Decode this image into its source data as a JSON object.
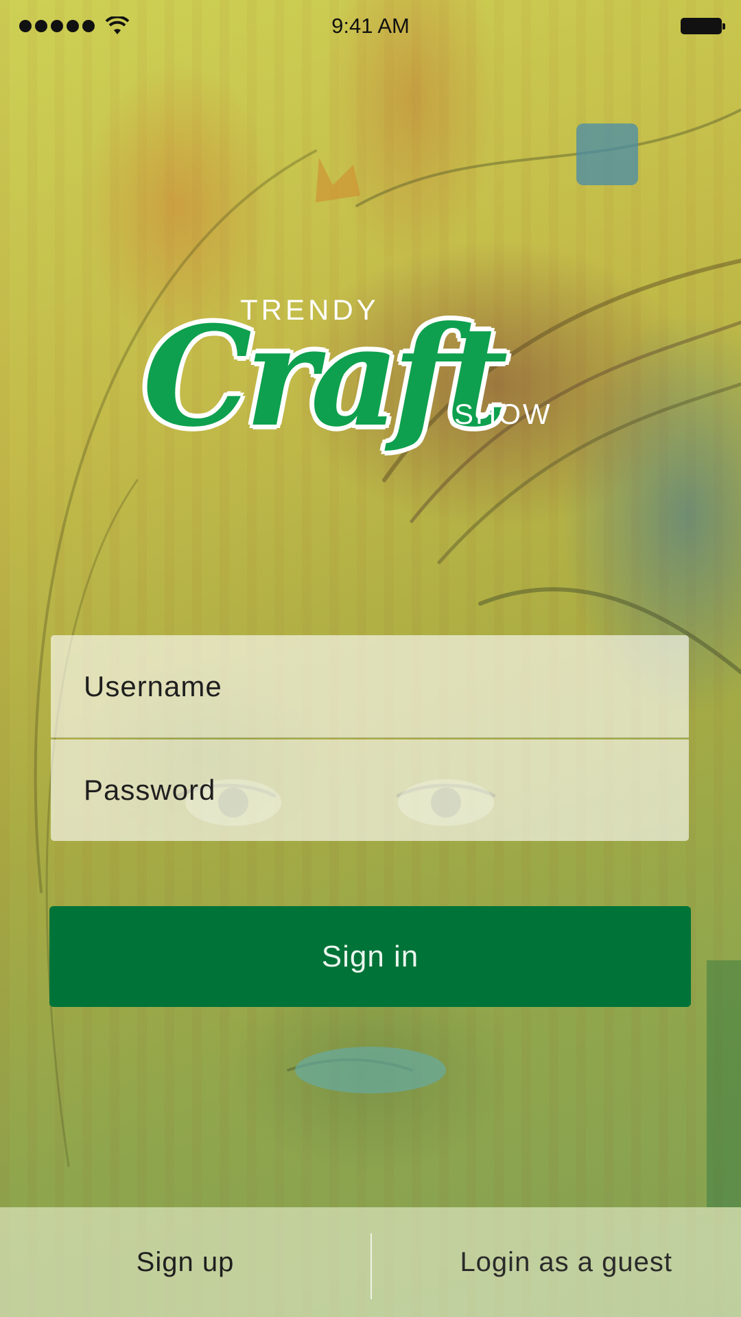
{
  "status_bar": {
    "time": "9:41 AM",
    "signal_icon": "signal-dots-icon",
    "wifi_icon": "wifi-icon",
    "battery_icon": "battery-icon"
  },
  "logo": {
    "line1": "TRENDY",
    "line2": "Craft",
    "line3": "SHOW"
  },
  "form": {
    "username_placeholder": "Username",
    "password_placeholder": "Password",
    "signin_label": "Sign in"
  },
  "bottom": {
    "signup_label": "Sign up",
    "guest_label": "Login as a guest"
  },
  "colors": {
    "brand_green": "#007338",
    "logo_green": "#0ea04e"
  }
}
